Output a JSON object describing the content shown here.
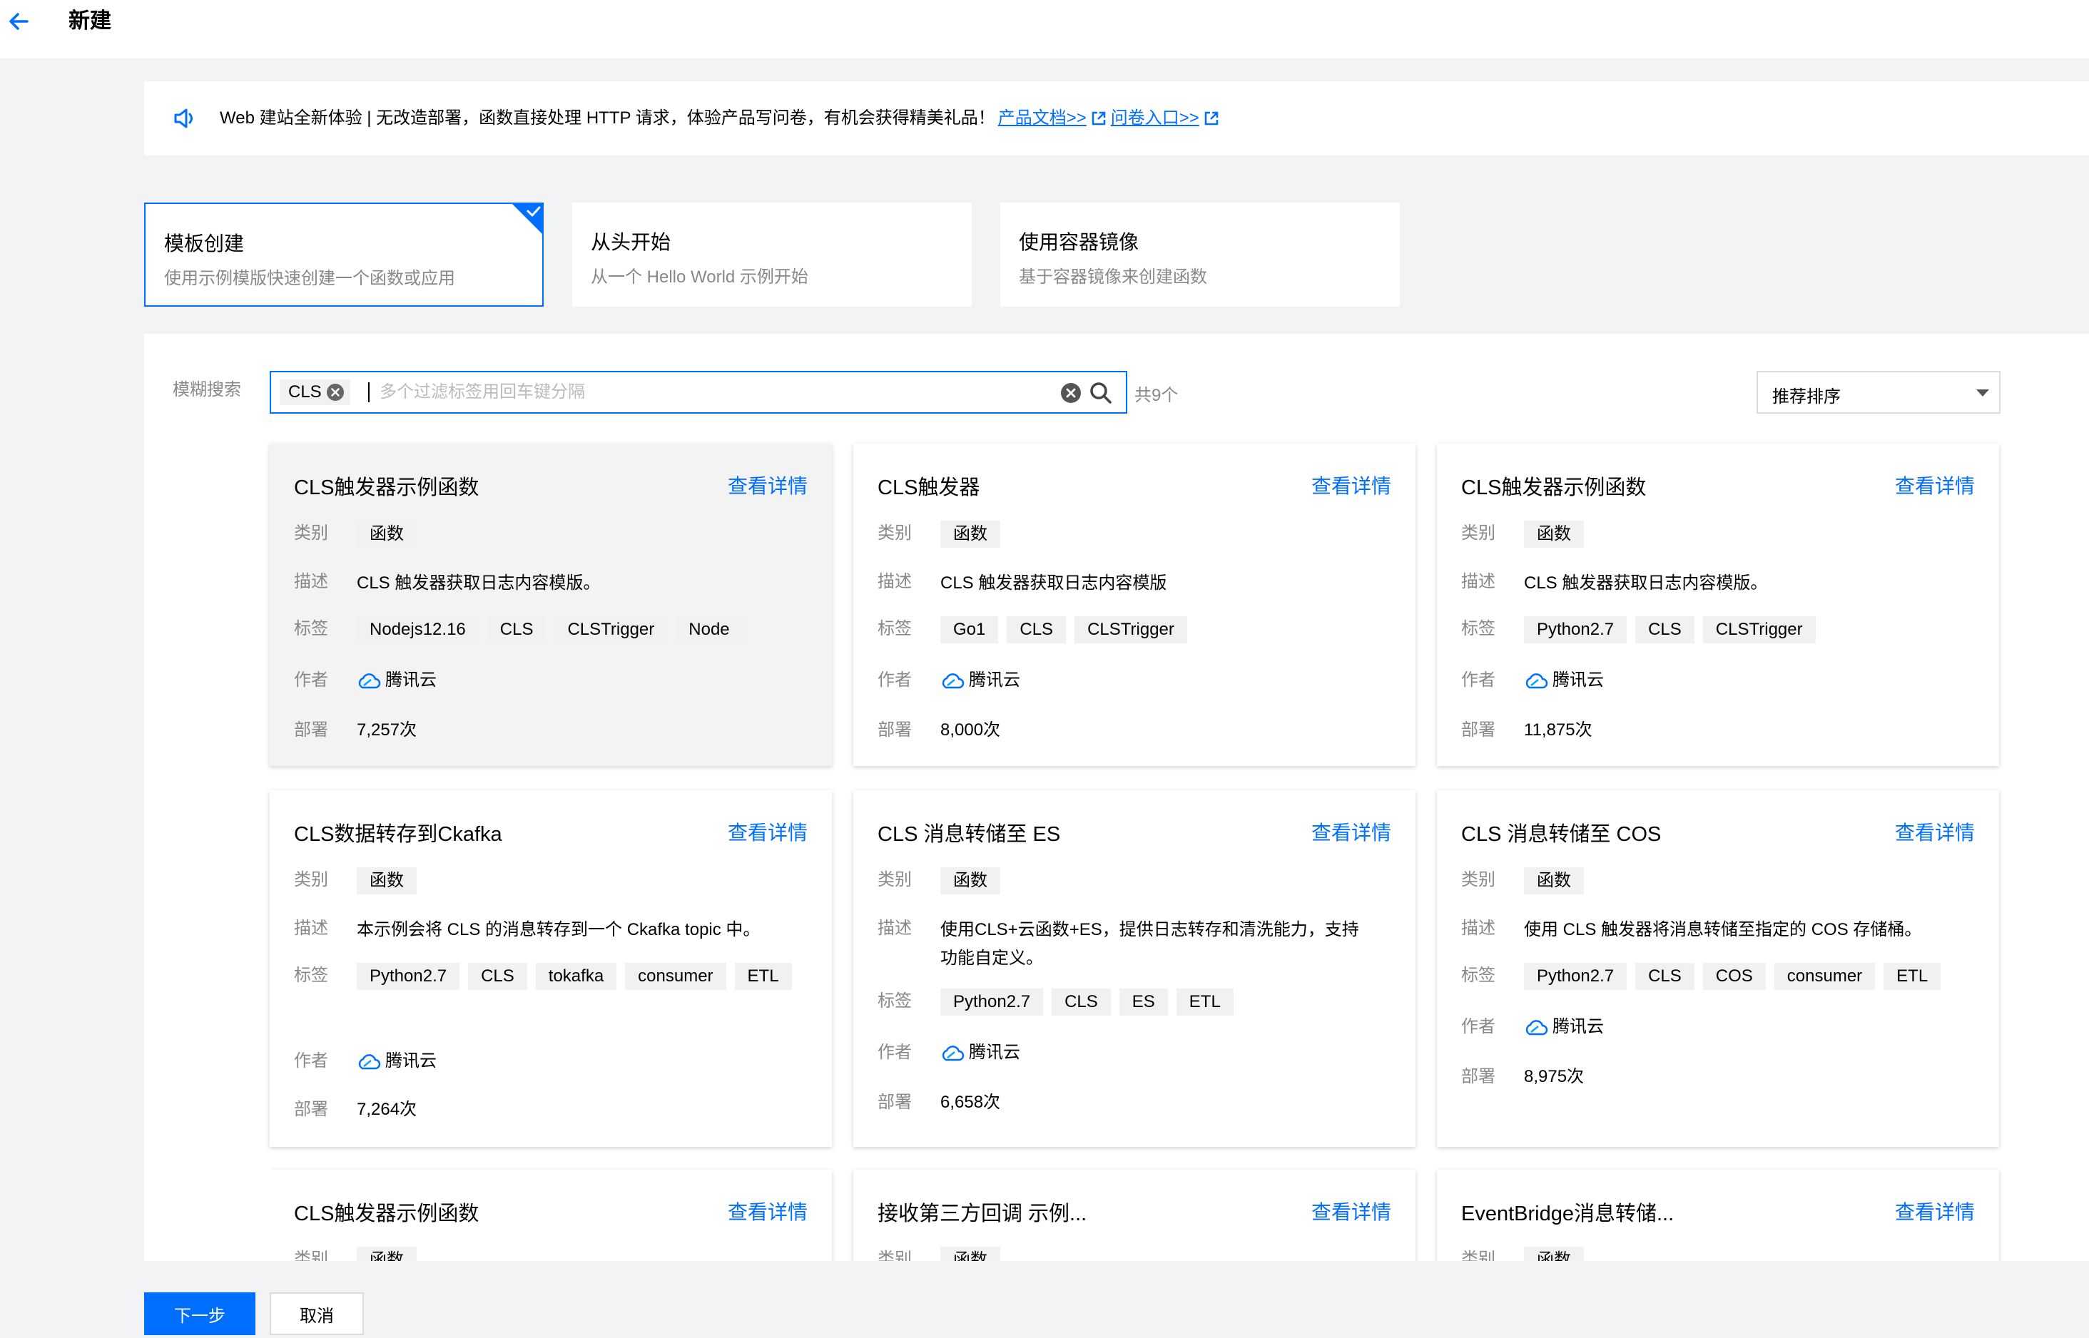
{
  "header": {
    "title": "新建"
  },
  "notice": {
    "text": "Web 建站全新体验 | 无改造部署，函数直接处理 HTTP 请求，体验产品写问卷，有机会获得精美礼品！",
    "link_docs": "产品文档>>",
    "link_survey": "问卷入口>>"
  },
  "modes": [
    {
      "title": "模板创建",
      "desc": "使用示例模版快速创建一个函数或应用",
      "selected": true
    },
    {
      "title": "从头开始",
      "desc": "从一个 Hello World 示例开始",
      "selected": false
    },
    {
      "title": "使用容器镜像",
      "desc": "基于容器镜像来创建函数",
      "selected": false
    }
  ],
  "search": {
    "label": "模糊搜索",
    "chip": "CLS",
    "placeholder": "多个过滤标签用回车键分隔",
    "count": "共9个"
  },
  "sort": {
    "selected": "推荐排序"
  },
  "labels": {
    "category": "类别",
    "description": "描述",
    "tags": "标签",
    "author": "作者",
    "deploy": "部署",
    "detail": "查看详情"
  },
  "cards": [
    {
      "title": "CLS触发器示例函数",
      "category": "函数",
      "desc": "CLS 触发器获取日志内容模版。",
      "tags": [
        "Nodejs12.16",
        "CLS",
        "CLSTrigger",
        "Node"
      ],
      "author": "腾讯云",
      "deploy": "7,257次"
    },
    {
      "title": "CLS触发器",
      "category": "函数",
      "desc": "CLS 触发器获取日志内容模版",
      "tags": [
        "Go1",
        "CLS",
        "CLSTrigger"
      ],
      "author": "腾讯云",
      "deploy": "8,000次"
    },
    {
      "title": "CLS触发器示例函数",
      "category": "函数",
      "desc": "CLS 触发器获取日志内容模版。",
      "tags": [
        "Python2.7",
        "CLS",
        "CLSTrigger"
      ],
      "author": "腾讯云",
      "deploy": "11,875次"
    },
    {
      "title": "CLS数据转存到Ckafka",
      "category": "函数",
      "desc": "本示例会将 CLS 的消息转存到一个 Ckafka topic 中。",
      "tags": [
        "Python2.7",
        "CLS",
        "tokafka",
        "consumer",
        "ETL"
      ],
      "author": "腾讯云",
      "deploy": "7,264次"
    },
    {
      "title": "CLS 消息转储至 ES",
      "category": "函数",
      "desc": "使用CLS+云函数+ES，提供日志转存和清洗能力，支持功能自定义。",
      "tags": [
        "Python2.7",
        "CLS",
        "ES",
        "ETL"
      ],
      "author": "腾讯云",
      "deploy": "6,658次"
    },
    {
      "title": "CLS 消息转储至 COS",
      "category": "函数",
      "desc": "使用 CLS 触发器将消息转储至指定的 COS 存储桶。",
      "tags": [
        "Python2.7",
        "CLS",
        "COS",
        "consumer",
        "ETL"
      ],
      "author": "腾讯云",
      "deploy": "8,975次"
    },
    {
      "title": "CLS触发器示例函数",
      "category": "函数"
    },
    {
      "title": "接收第三方回调 示例...",
      "category": "函数"
    },
    {
      "title": "EventBridge消息转储...",
      "category": "函数"
    }
  ],
  "footer": {
    "next": "下一步",
    "cancel": "取消"
  }
}
